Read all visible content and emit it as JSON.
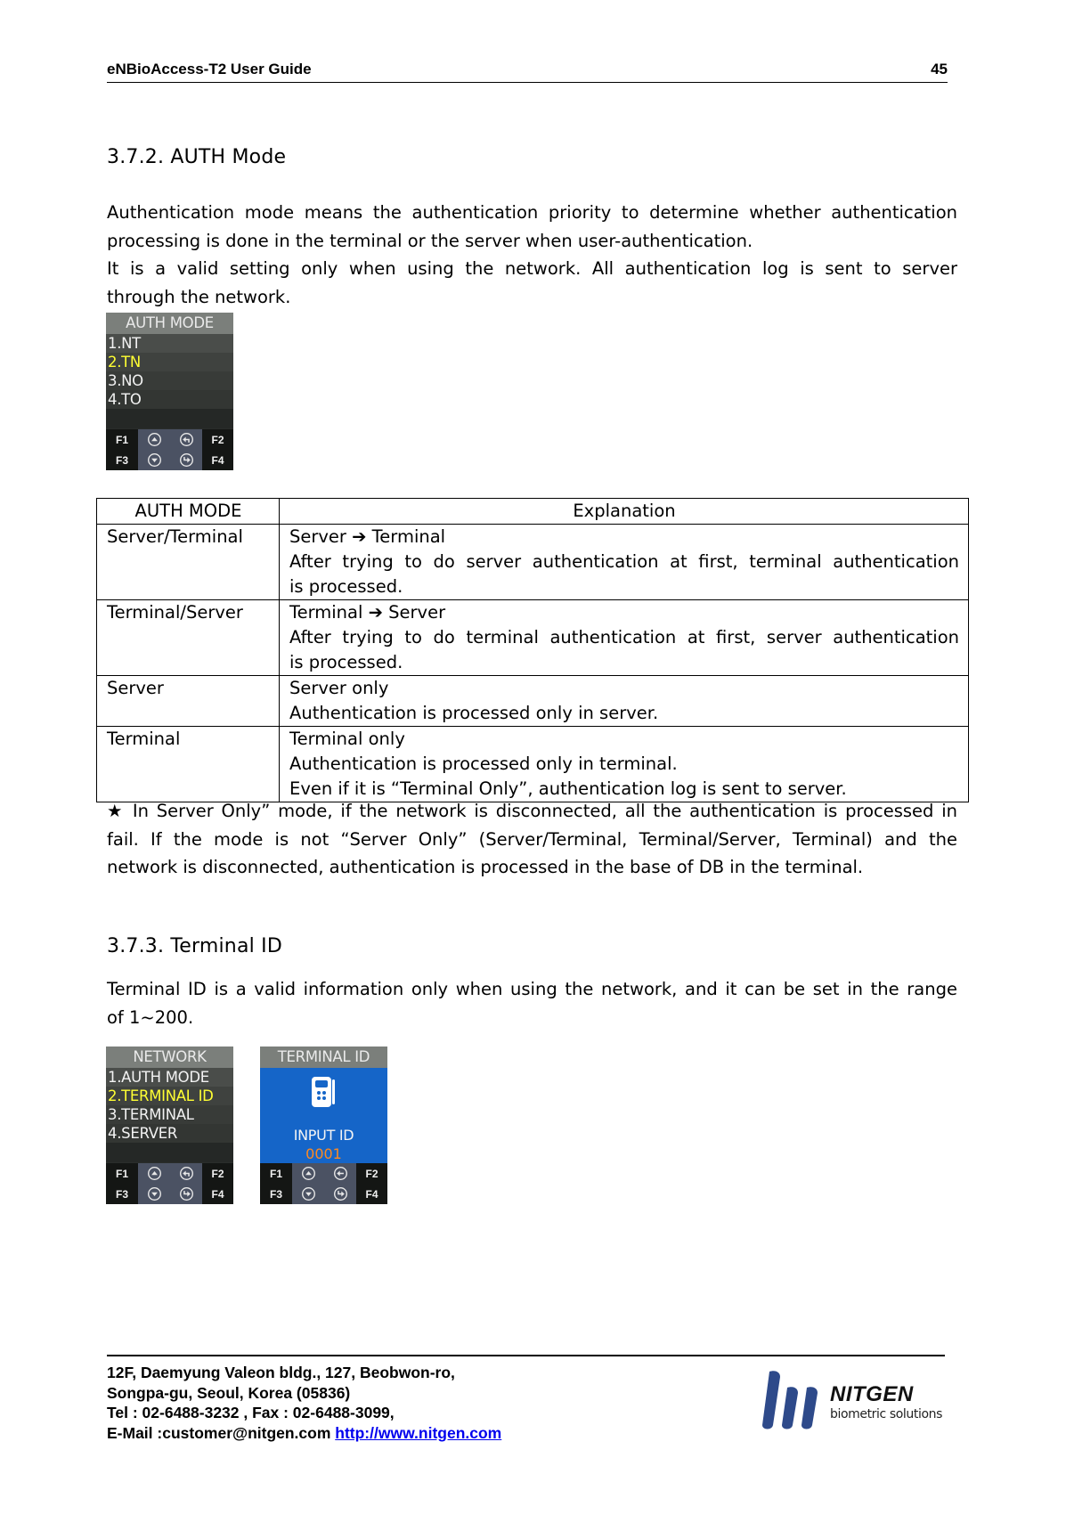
{
  "header": {
    "title": "eNBioAccess-T2 User Guide",
    "page_number": "45"
  },
  "section_auth": {
    "heading": "3.7.2. AUTH Mode",
    "paragraph_lines": [
      "Authentication mode means the authentication priority to determine whether authentication",
      "processing is done in the terminal or the server when user-authentication.",
      "It is a valid setting only when using the network. All authentication log is sent to server",
      "through the network."
    ],
    "device": {
      "title": "AUTH MODE",
      "items": [
        {
          "label": "1.NT",
          "selected": false
        },
        {
          "label": "2.TN",
          "selected": true
        },
        {
          "label": "3.NO",
          "selected": false
        },
        {
          "label": "4.TO",
          "selected": false
        }
      ],
      "fkeys": {
        "f1": "F1",
        "f2": "F2",
        "f3": "F3",
        "f4": "F4"
      }
    }
  },
  "table": {
    "headers": [
      "AUTH MODE",
      "Explanation"
    ],
    "rows": [
      {
        "mode": "Server/Terminal",
        "lines": [
          "Server ➔ Terminal",
          "After trying to do server authentication at first, terminal authentication",
          "is processed."
        ]
      },
      {
        "mode": "Terminal/Server",
        "lines": [
          "Terminal ➔ Server",
          "After trying to do terminal authentication at first, server authentication",
          "is processed."
        ]
      },
      {
        "mode": "Server",
        "lines": [
          "Server only",
          "Authentication is processed only in server."
        ]
      },
      {
        "mode": "Terminal",
        "lines": [
          "Terminal only",
          "Authentication is processed only in terminal.",
          "Even if it is “Terminal Only”, authentication log is sent to server."
        ]
      }
    ]
  },
  "note": {
    "lines": [
      "★ In Server Only” mode, if the network is disconnected, all the authentication is processed in",
      "fail. If the mode is not “Server Only” (Server/Terminal, Terminal/Server, Terminal) and the",
      "network is disconnected, authentication is processed in the base of DB in the terminal."
    ]
  },
  "section_terminal": {
    "heading": "3.7.3. Terminal ID",
    "paragraph_lines": [
      "Terminal ID is a valid information only when using the network, and it can be set in the range",
      "of 1~200."
    ],
    "network_device": {
      "title": "NETWORK",
      "items": [
        {
          "label": "1.AUTH MODE",
          "selected": false
        },
        {
          "label": "2.TERMINAL ID",
          "selected": true
        },
        {
          "label": "3.TERMINAL",
          "selected": false
        },
        {
          "label": "4.SERVER",
          "selected": false
        }
      ],
      "fkeys": {
        "f1": "F1",
        "f2": "F2",
        "f3": "F3",
        "f4": "F4"
      }
    },
    "terminal_device": {
      "title": "TERMINAL ID",
      "input_label": "INPUT ID",
      "input_value": "0001",
      "fkeys": {
        "f1": "F1",
        "f2": "F2",
        "f3": "F3",
        "f4": "F4"
      }
    }
  },
  "footer": {
    "address_line1": "12F, Daemyung Valeon bldg., 127, Beobwon-ro,",
    "address_line2": "Songpa-gu, Seoul, Korea (05836)",
    "phone_line": "Tel : 02-6488-3232 , Fax : 02-6488-3099,",
    "email_prefix": "E-Mail :customer@nitgen.com ",
    "website": "http://www.nitgen.com",
    "logo_name": "NITGEN",
    "logo_tagline": "biometric solutions",
    "colors": {
      "logo_blue": "#2e4a8a",
      "link_blue": "#0000ee"
    }
  }
}
